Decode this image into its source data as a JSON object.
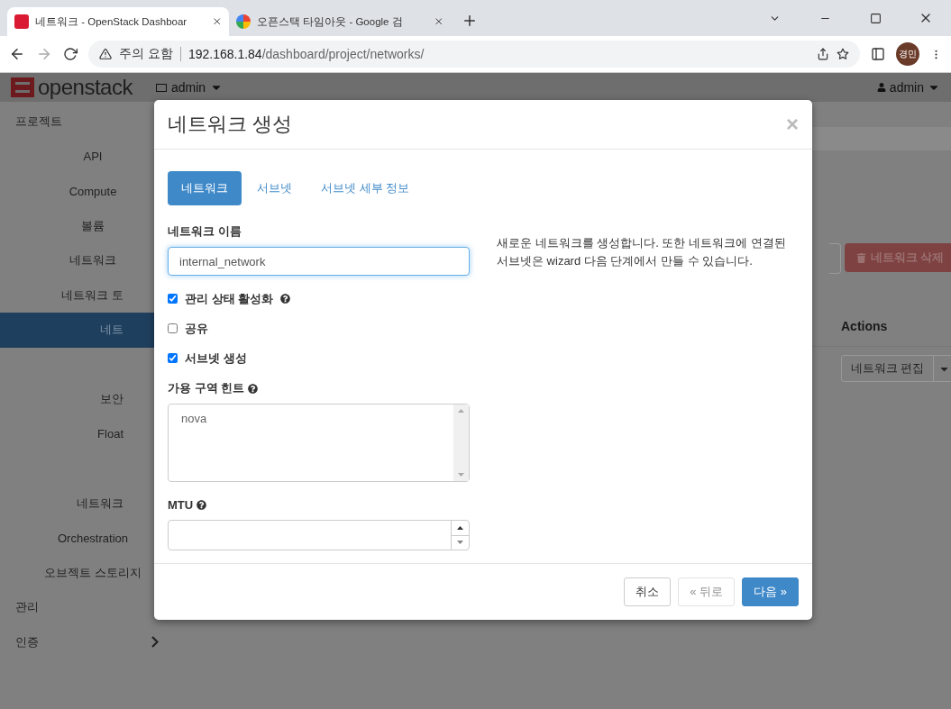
{
  "browser": {
    "tabs": [
      {
        "title": "네트워크 - OpenStack Dashboar",
        "selected": true
      },
      {
        "title": "오픈스택 타임아웃 - Google 검",
        "selected": false
      }
    ],
    "address": {
      "security": "주의 요함",
      "host": "192.168.1.84",
      "path": "/dashboard/project/networks/"
    },
    "profile": "경민"
  },
  "topbar": {
    "brand": "openstack",
    "project": "admin",
    "user": "admin"
  },
  "sidebar": [
    {
      "label": "프로젝트",
      "hovered": false,
      "children": [
        {
          "label": "API"
        },
        {
          "label": "Compute"
        },
        {
          "label": "볼륨"
        },
        {
          "label": "네트워크",
          "children": [
            {
              "kind": "item",
              "label": "네트워크 토",
              "selected": false
            },
            {
              "kind": "item",
              "label": "네트",
              "selected": true
            },
            {
              "kind": "covered",
              "selected": false
            },
            {
              "kind": "item",
              "label": "보안",
              "selected": false
            },
            {
              "kind": "item",
              "label": "Float",
              "selected": false
            },
            {
              "kind": "covered",
              "selected": false
            },
            {
              "kind": "item",
              "label": "네트워크",
              "selected": false
            }
          ]
        },
        {
          "label": "Orchestration"
        },
        {
          "label": "오브젝트 스토리지"
        }
      ]
    },
    {
      "label": "관리",
      "hovered": false
    },
    {
      "label": "인증",
      "hovered": true
    }
  ],
  "page": {
    "delete_button": "네트워크 삭제",
    "actions_header": "Actions",
    "edit_button": "네트워크 편집"
  },
  "modal": {
    "title": "네트워크 생성",
    "close": "×",
    "tabs": [
      {
        "label": "네트워크",
        "selected": true
      },
      {
        "label": "서브넷",
        "selected": false
      },
      {
        "label": "서브넷 세부 정보",
        "selected": false
      }
    ],
    "name_label": "네트워크 이름",
    "name_value": "internal_network",
    "checkboxes": [
      {
        "label": "관리 상태 활성화",
        "checked": true,
        "help": true
      },
      {
        "label": "공유",
        "checked": false,
        "help": false
      },
      {
        "label": "서브넷 생성",
        "checked": true,
        "help": false
      }
    ],
    "az_label": "가용 구역 힌트",
    "az_options": [
      "nova"
    ],
    "mtu_label": "MTU",
    "description": "새로운 네트워크를 생성합니다. 또한 네트워크에 연결된 서브넷은 wizard 다음 단계에서 만들 수 있습니다.",
    "buttons": [
      {
        "label": "취소",
        "kind": "default",
        "disabled": false
      },
      {
        "label": "« 뒤로",
        "kind": "default",
        "disabled": true
      },
      {
        "label": "다음 »",
        "kind": "primary",
        "disabled": false
      }
    ]
  }
}
